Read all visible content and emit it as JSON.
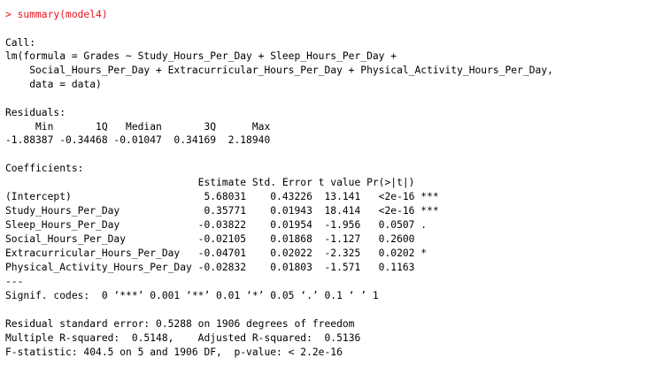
{
  "command": "> summary(model4)",
  "call_header": "Call:",
  "call_lines": [
    "lm(formula = Grades ~ Study_Hours_Per_Day + Sleep_Hours_Per_Day + ",
    "    Social_Hours_Per_Day + Extracurricular_Hours_Per_Day + Physical_Activity_Hours_Per_Day, ",
    "    data = data)"
  ],
  "residuals_header": "Residuals:",
  "residuals_labels": "     Min       1Q   Median       3Q      Max ",
  "residuals_values": "-1.88387 -0.34468 -0.01047  0.34169  2.18940 ",
  "coefficients_header": "Coefficients:",
  "coefficients_columns": "                                Estimate Std. Error t value Pr(>|t|)    ",
  "coefficients_rows": [
    "(Intercept)                      5.68031    0.43226  13.141   <2e-16 ***",
    "Study_Hours_Per_Day              0.35771    0.01943  18.414   <2e-16 ***",
    "Sleep_Hours_Per_Day             -0.03822    0.01954  -1.956   0.0507 .  ",
    "Social_Hours_Per_Day            -0.02105    0.01868  -1.127   0.2600    ",
    "Extracurricular_Hours_Per_Day   -0.04701    0.02022  -2.325   0.0202 *  ",
    "Physical_Activity_Hours_Per_Day -0.02832    0.01803  -1.571   0.1163    "
  ],
  "separator": "---",
  "signif_codes": "Signif. codes:  0 ‘***’ 0.001 ‘**’ 0.01 ‘*’ 0.05 ‘.’ 0.1 ‘ ’ 1",
  "residual_standard_error": "Residual standard error: 0.5288 on 1906 degrees of freedom",
  "r_squared": "Multiple R-squared:  0.5148,\tAdjusted R-squared:  0.5136 ",
  "f_statistic": "F-statistic: 404.5 on 5 and 1906 DF,  p-value: < 2.2e-16",
  "colors": {
    "command": "#e8141a",
    "output": "#000000",
    "background": "#ffffff"
  }
}
